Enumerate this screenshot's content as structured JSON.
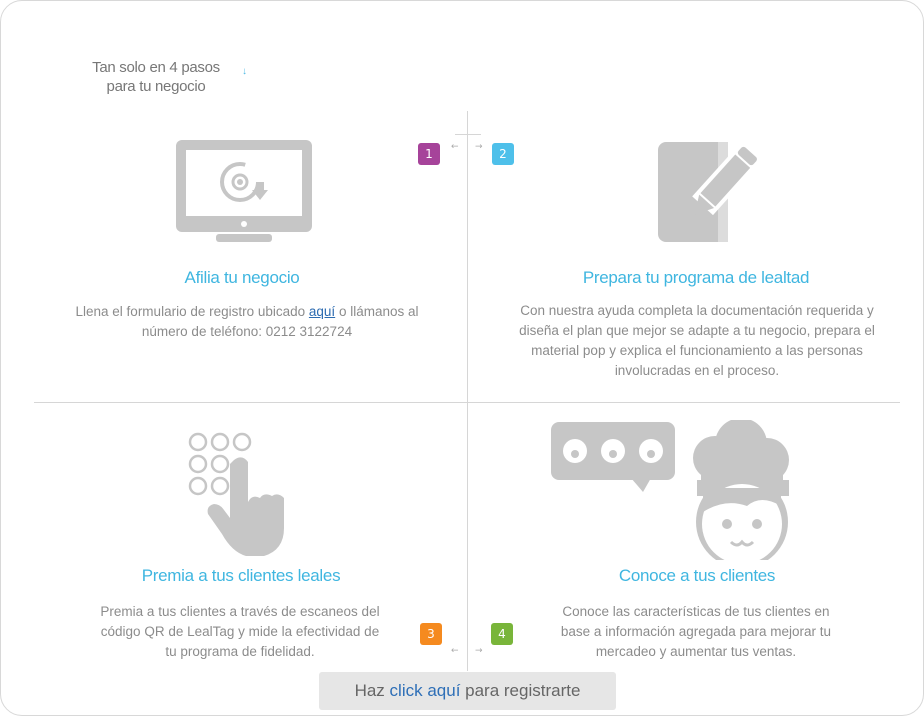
{
  "intro": {
    "line1": "Tan solo en 4 pasos",
    "line2": "para tu negocio",
    "arrow": "↓"
  },
  "steps": [
    {
      "number": "1",
      "color": "#a6439a",
      "title": "Afilia tu negocio",
      "desc_before": "Llena el formulario de registro ubicado ",
      "desc_link": "aquí",
      "desc_after": " o llámanos al número de teléfono: 0212 3122724",
      "icon": "monitor-refresh-icon"
    },
    {
      "number": "2",
      "color": "#4ec0ea",
      "title": "Prepara tu programa de lealtad",
      "desc": "Con nuestra ayuda completa la documentación requerida y diseña el plan que mejor se adapte a tu negocio, prepara el material pop y explica el funcionamiento a las personas involucradas en el proceso.",
      "icon": "book-pencil-icon"
    },
    {
      "number": "3",
      "color": "#f58a1f",
      "title": "Premia a tus clientes leales",
      "desc": "Premia a tus clientes a través de escaneos del código QR de LealTag y mide la efectividad de tu programa de fidelidad.",
      "icon": "hand-keypad-icon"
    },
    {
      "number": "4",
      "color": "#79b53a",
      "title": "Conoce a tus clientes",
      "desc": "Conoce las características de tus clientes en base a información agregada para mejorar tu mercadeo y aumentar tus ventas.",
      "icon": "chef-speech-icon"
    }
  ],
  "cta": {
    "before": "Haz ",
    "link": "click aquí",
    "after": " para registrarte"
  },
  "arrows": {
    "left": "←",
    "right": "→"
  }
}
